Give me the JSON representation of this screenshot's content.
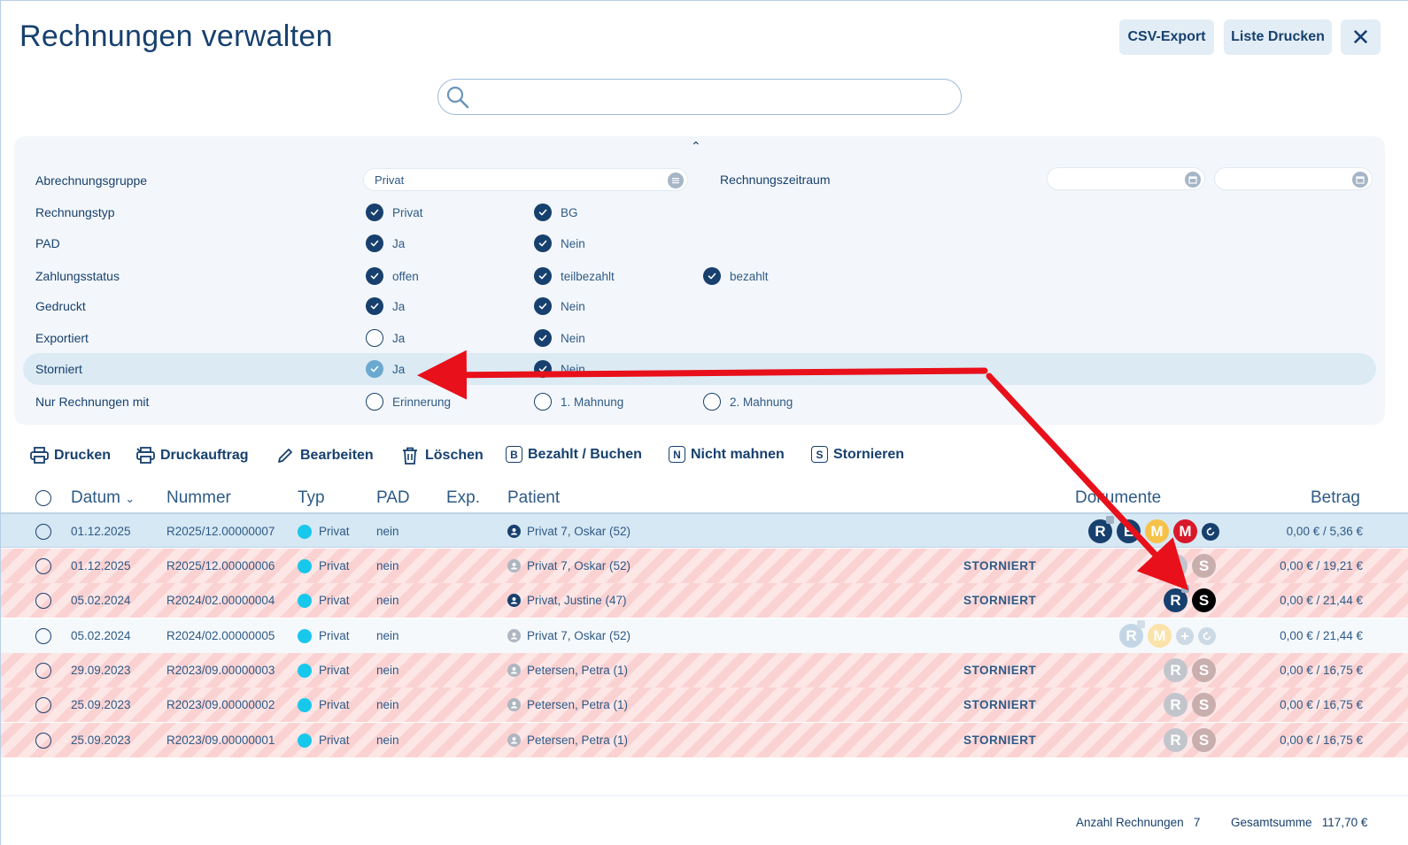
{
  "page": {
    "title": "Rechnungen verwalten"
  },
  "top_buttons": {
    "csv": "CSV-Export",
    "print_list": "Liste Drucken",
    "close": "✕"
  },
  "search": {
    "placeholder": "",
    "value": ""
  },
  "filters": {
    "abrechnungsgruppe": {
      "label": "Abrechnungsgruppe",
      "value": "Privat"
    },
    "rechnungszeitraum": {
      "label": "Rechnungszeitraum",
      "from": "",
      "to": ""
    },
    "rechnungstyp": {
      "label": "Rechnungstyp",
      "options": [
        {
          "label": "Privat",
          "checked": true
        },
        {
          "label": "BG",
          "checked": true
        }
      ]
    },
    "pad": {
      "label": "PAD",
      "options": [
        {
          "label": "Ja",
          "checked": true
        },
        {
          "label": "Nein",
          "checked": true
        }
      ]
    },
    "zahlungsstatus": {
      "label": "Zahlungsstatus",
      "options": [
        {
          "label": "offen",
          "checked": true
        },
        {
          "label": "teilbezahlt",
          "checked": true
        },
        {
          "label": "bezahlt",
          "checked": true
        }
      ]
    },
    "gedruckt": {
      "label": "Gedruckt",
      "options": [
        {
          "label": "Ja",
          "checked": true
        },
        {
          "label": "Nein",
          "checked": true
        }
      ]
    },
    "exportiert": {
      "label": "Exportiert",
      "options": [
        {
          "label": "Ja",
          "checked": false
        },
        {
          "label": "Nein",
          "checked": true
        }
      ]
    },
    "storniert": {
      "label": "Storniert",
      "options": [
        {
          "label": "Ja",
          "checked": true
        },
        {
          "label": "Nein",
          "checked": true
        }
      ]
    },
    "nur_mit": {
      "label": "Nur Rechnungen mit",
      "options": [
        {
          "label": "Erinnerung",
          "checked": false
        },
        {
          "label": "1. Mahnung",
          "checked": false
        },
        {
          "label": "2. Mahnung",
          "checked": false
        }
      ]
    }
  },
  "toolbar": {
    "drucken": "Drucken",
    "druckauftrag": "Druckauftrag",
    "bearbeiten": "Bearbeiten",
    "loeschen": "Löschen",
    "bezahlt_letter": "B",
    "bezahlt": "Bezahlt / Buchen",
    "nicht_mahnen_letter": "N",
    "nicht_mahnen": "Nicht mahnen",
    "stornieren_letter": "S",
    "stornieren": "Stornieren"
  },
  "table": {
    "headers": {
      "datum": "Datum",
      "nummer": "Nummer",
      "typ": "Typ",
      "pad": "PAD",
      "exp": "Exp.",
      "patient": "Patient",
      "dokumente": "Dokumente",
      "betrag": "Betrag"
    },
    "storno_label": "STORNIERT",
    "rows": [
      {
        "datum": "01.12.2025",
        "nummer": "R2025/12.00000007",
        "typ": "Privat",
        "pad": "nein",
        "patient": "Privat 7, Oskar (52)",
        "betrag": "0,00 € / 5,36 €",
        "status": "selected"
      },
      {
        "datum": "01.12.2025",
        "nummer": "R2025/12.00000006",
        "typ": "Privat",
        "pad": "nein",
        "patient": "Privat 7, Oskar (52)",
        "betrag": "0,00 € / 19,21 €",
        "status": "storniert"
      },
      {
        "datum": "05.02.2024",
        "nummer": "R2024/02.00000004",
        "typ": "Privat",
        "pad": "nein",
        "patient": "Privat, Justine (47)",
        "betrag": "0,00 € / 21,44 €",
        "status": "storniert"
      },
      {
        "datum": "05.02.2024",
        "nummer": "R2024/02.00000005",
        "typ": "Privat",
        "pad": "nein",
        "patient": "Privat 7, Oskar (52)",
        "betrag": "0,00 € / 21,44 €",
        "status": "plain"
      },
      {
        "datum": "29.09.2023",
        "nummer": "R2023/09.00000003",
        "typ": "Privat",
        "pad": "nein",
        "patient": "Petersen, Petra (1)",
        "betrag": "0,00 € / 16,75 €",
        "status": "storniert"
      },
      {
        "datum": "25.09.2023",
        "nummer": "R2023/09.00000002",
        "typ": "Privat",
        "pad": "nein",
        "patient": "Petersen, Petra (1)",
        "betrag": "0,00 € / 16,75 €",
        "status": "storniert"
      },
      {
        "datum": "25.09.2023",
        "nummer": "R2023/09.00000001",
        "typ": "Privat",
        "pad": "nein",
        "patient": "Petersen, Petra (1)",
        "betrag": "0,00 € / 16,75 €",
        "status": "storniert"
      }
    ]
  },
  "docs": {
    "R": "R",
    "E": "E",
    "M": "M",
    "S": "S"
  },
  "footer": {
    "anzahl_label": "Anzahl Rechnungen",
    "anzahl": "7",
    "summe_label": "Gesamtsumme",
    "summe": "117,70 €"
  },
  "colors": {
    "primary": "#17406e",
    "annotation": "#e8101a",
    "storno": "#f3a0a0",
    "typ_dot": "#17c8ec"
  }
}
